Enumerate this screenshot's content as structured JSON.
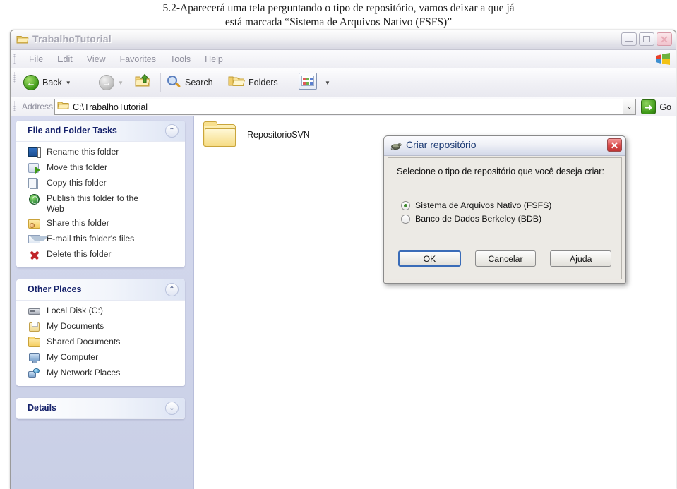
{
  "caption": {
    "line1": "5.2-Aparecerá uma tela perguntando o tipo de repositório, vamos deixar a que já",
    "line2": "está marcada “Sistema de Arquivos Nativo (FSFS)”"
  },
  "window": {
    "title": "TrabalhoTutorial",
    "icon": "folder-icon",
    "minimize_label": "Minimize",
    "maximize_label": "Maximize",
    "close_label": "✕"
  },
  "menubar": {
    "items": [
      {
        "label": "File"
      },
      {
        "label": "Edit"
      },
      {
        "label": "View"
      },
      {
        "label": "Favorites"
      },
      {
        "label": "Tools"
      },
      {
        "label": "Help"
      }
    ]
  },
  "toolbar": {
    "back_label": "Back",
    "search_label": "Search",
    "folders_label": "Folders",
    "caret": "▼",
    "back_arrow": "←",
    "forward_arrow": "→"
  },
  "address": {
    "label": "Address",
    "value": "C:\\TrabalhoTutorial",
    "dropdown_glyph": "⌄",
    "go_label": "Go",
    "go_arrow": "➜"
  },
  "sidebar": {
    "panels": [
      {
        "title": "File and Folder Tasks",
        "chevron": "⌃",
        "items": [
          {
            "label": "Rename this folder",
            "icon": "rename-icon"
          },
          {
            "label": "Move this folder",
            "icon": "move-icon"
          },
          {
            "label": "Copy this folder",
            "icon": "copy-icon"
          },
          {
            "label": "Publish this folder to the Web",
            "icon": "publish-web-icon"
          },
          {
            "label": "Share this folder",
            "icon": "share-folder-icon"
          },
          {
            "label": "E-mail this folder's files",
            "icon": "email-icon"
          },
          {
            "label": "Delete this folder",
            "icon": "delete-icon"
          }
        ]
      },
      {
        "title": "Other Places",
        "chevron": "⌃",
        "items": [
          {
            "label": "Local Disk (C:)",
            "icon": "local-disk-icon"
          },
          {
            "label": "My Documents",
            "icon": "my-documents-icon"
          },
          {
            "label": "Shared Documents",
            "icon": "shared-documents-icon"
          },
          {
            "label": "My Computer",
            "icon": "my-computer-icon"
          },
          {
            "label": "My Network Places",
            "icon": "my-network-places-icon"
          }
        ]
      },
      {
        "title": "Details",
        "chevron": "⌄",
        "items": []
      }
    ]
  },
  "content": {
    "items": [
      {
        "name": "RepositorioSVN",
        "icon": "folder-icon"
      }
    ]
  },
  "dialog": {
    "title": "Criar repositório",
    "icon": "tortoise-svn-icon",
    "close_label": "✕",
    "prompt": "Selecione o tipo de repositório que você deseja criar:",
    "options": [
      {
        "label": "Sistema de Arquivos Nativo (FSFS)",
        "selected": true
      },
      {
        "label": "Banco de Dados Berkeley (BDB)",
        "selected": false
      }
    ],
    "buttons": [
      {
        "label": "OK",
        "default": true
      },
      {
        "label": "Cancelar",
        "default": false
      },
      {
        "label": "Ajuda",
        "default": false
      }
    ]
  },
  "colors": {
    "sidebar_bg": "#d6daee",
    "panel_title": "#16226b",
    "dialog_title": "#1d3b73",
    "accent_green": "#3f9a18",
    "radio_dot": "#3f8a2e",
    "close_red": "#d94a4a"
  }
}
